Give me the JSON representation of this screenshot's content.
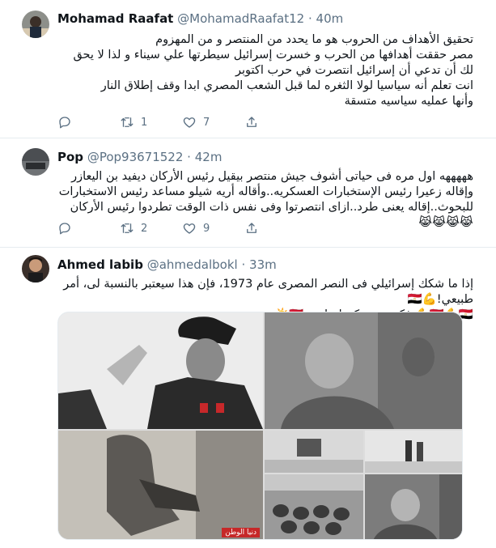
{
  "tweets": [
    {
      "name": "Mohamad Raafat",
      "handle": "@MohamadRaafat12",
      "sep": "·",
      "time": "40m",
      "text": "تحقيق الأهداف من الحروب هو ما يحدد من المنتصر و من المهزوم\nمصر حققت أهدافها من الحرب و خسرت إسرائيل سيطرتها علي سيناء و لذا لا يحق لك أن تدعي أن إسرائيل انتصرت في حرب اكتوبر\nانت تعلم أنه سياسيا لولا الثغره لما قبل الشعب المصري ابدا وقف إطلاق النار\nوأنها عمليه سياسيه متسقة",
      "reply_count": "",
      "retweet_count": "1",
      "like_count": "7"
    },
    {
      "name": "Pop",
      "handle": "@Pop93671522",
      "sep": "·",
      "time": "42m",
      "text": "هههههه اول مره فى حياتى أشوف جيش منتصر بيقيل رئيس الأركان ديفيد بن اليعازر وإقاله زعيرا رئيس الإستخبارات العسكريه..وأقاله أريه شيلو مساعد رئيس الاستخبارات للبحوث..إقاله يعنى طرد..ازاى انتصرتوا وفى نفس ذات الوقت تطردوا رئيس الأركان😹😹😹😹",
      "reply_count": "",
      "retweet_count": "2",
      "like_count": "9"
    },
    {
      "name": "Ahmed labib",
      "handle": "@ahmedalbokl",
      "sep": "·",
      "time": "33m",
      "text": "إذا ما شكك إسرائيلي فى النصر المصرى عام 1973، فإن هذا سيعتبر بالنسبة لى، أمر طبيعي!💪🇪🇬\n🇪🇬💪🇪🇬💪 فكروهم ونكدوا عليهم 🇪🇬☀️",
      "watermark": "دنيا الوطن"
    }
  ],
  "icons": {
    "reply": "reply-icon",
    "retweet": "retweet-icon",
    "like": "heart-icon",
    "share": "share-icon"
  },
  "colors": {
    "secondary_text": "#5b7083",
    "divider": "#e6ecf0",
    "watermark_bg": "#c62828"
  }
}
